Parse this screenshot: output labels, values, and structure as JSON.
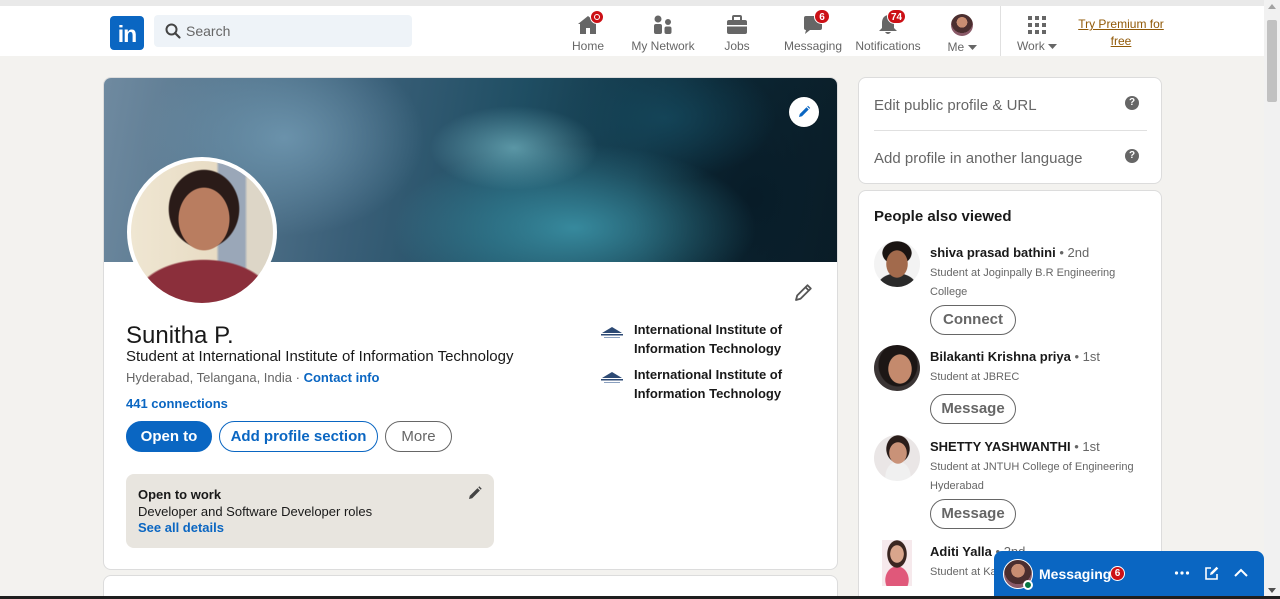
{
  "brand": {
    "logo_text": "in",
    "accent": "#0a66c2",
    "badge_color": "#cc1016"
  },
  "search": {
    "placeholder": "Search"
  },
  "nav": {
    "home": {
      "label": "Home",
      "icon": "home-icon"
    },
    "network": {
      "label": "My Network",
      "icon": "people-icon"
    },
    "jobs": {
      "label": "Jobs",
      "icon": "briefcase-icon"
    },
    "messaging": {
      "label": "Messaging",
      "icon": "chat-icon",
      "badge": "6"
    },
    "notifications": {
      "label": "Notifications",
      "icon": "bell-icon",
      "badge": "74"
    },
    "me": {
      "label": "Me",
      "icon": "chevron-down-icon"
    },
    "work": {
      "label": "Work",
      "icon": "grid-icon"
    },
    "premium": {
      "line1": "Try Premium for",
      "line2": "free"
    }
  },
  "profile": {
    "name": "Sunitha P.",
    "headline": "Student at International Institute of Information Technology",
    "location": "Hyderabad, Telangana, India",
    "separator": "·",
    "contact_link": "Contact info",
    "connections": "441 connections",
    "buttons": {
      "open_to": "Open to",
      "add_section": "Add profile section",
      "more": "More"
    },
    "education": [
      {
        "name": "International Institute of Information Technology"
      },
      {
        "name": "International Institute of Information Technology"
      }
    ],
    "open_to_work": {
      "title": "Open to work",
      "roles": "Developer and Software Developer roles",
      "link": "See all details"
    }
  },
  "sidebar": {
    "edit_public_profile": "Edit public profile & URL",
    "add_language": "Add profile in another language",
    "help_glyph": "?",
    "people_title": "People also viewed",
    "people": [
      {
        "name": "shiva prasad bathini",
        "degree": "• 2nd",
        "desc": "Student at Joginpally B.R Engineering College",
        "action": "Connect"
      },
      {
        "name": "Bilakanti Krishna priya",
        "degree": "• 1st",
        "desc": "Student at JBREC",
        "action": "Message"
      },
      {
        "name": "SHETTY YASHWANTHI",
        "degree": "• 1st",
        "desc": "Student at JNTUH College of Engineering Hyderabad",
        "action": "Message"
      },
      {
        "name": "Aditi Yalla",
        "degree": "• 2nd",
        "desc": "Student at Ka... Engineering",
        "action": ""
      }
    ]
  },
  "messaging_tray": {
    "label": "Messaging",
    "badge": "6"
  }
}
